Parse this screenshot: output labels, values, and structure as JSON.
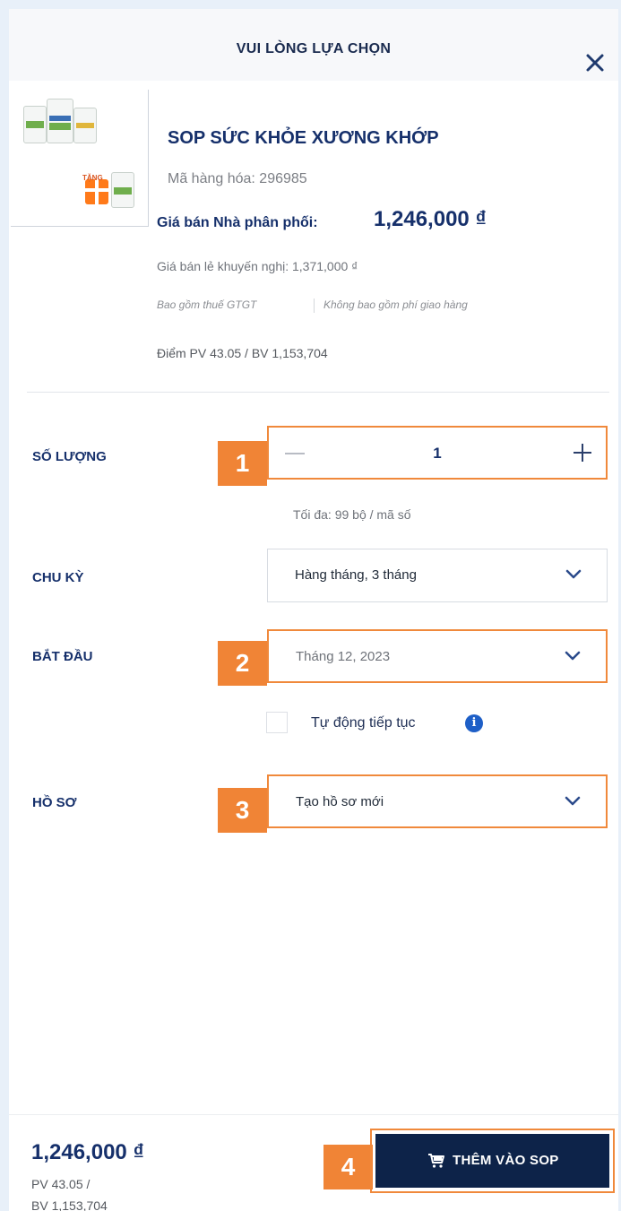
{
  "header": {
    "title": "VUI LÒNG LỰA CHỌN",
    "close_icon": "close-icon"
  },
  "product": {
    "name": "SOP SỨC KHỎE XƯƠNG KHỚP",
    "sku": "Mã hàng hóa: 296985",
    "distributor_price_label": "Giá bán Nhà phân phối:",
    "distributor_price": "1,246,000 ₫",
    "retail_price": "Giá bán lẻ khuyến nghị: 1,371,000 ₫",
    "tax_note": "Bao gồm thuế GTGT",
    "shipping_note": "Không bao gồm phí giao hàng",
    "points": "Điểm PV 43.05 / BV 1,153,704",
    "gift_tag": "TẶNG"
  },
  "form": {
    "quantity_label": "SỐ LƯỢNG",
    "quantity_value": "1",
    "quantity_max_note": "Tối đa: 99 bộ / mã số",
    "cycle_label": "CHU KỲ",
    "cycle_value": "Hàng tháng, 3 tháng",
    "start_label": "BẮT ĐẦU",
    "start_value": "Tháng 12, 2023",
    "auto_renew_label": "Tự động tiếp tục",
    "auto_renew_checked": false,
    "profile_label": "HỒ SƠ",
    "profile_value": "Tạo hồ sơ mới"
  },
  "callouts": {
    "one": "1",
    "two": "2",
    "three": "3",
    "four": "4"
  },
  "footer": {
    "total_price": "1,246,000 ₫",
    "pv": "PV 43.05 /",
    "bv": "BV 1,153,704",
    "add_button_label": "THÊM VÀO SOP"
  },
  "colors": {
    "brand_navy": "#0d2349",
    "highlight_orange": "#f08436",
    "info_blue": "#1e5fc7"
  }
}
